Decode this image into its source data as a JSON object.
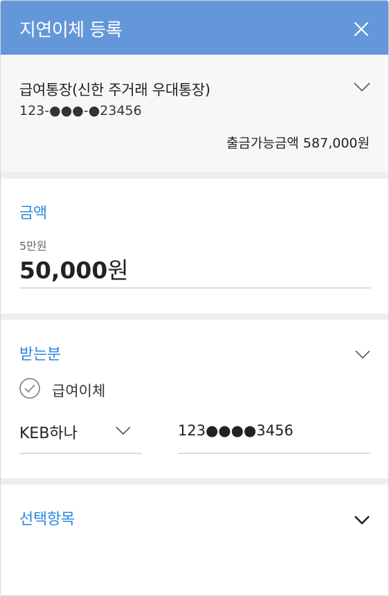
{
  "header": {
    "title": "지연이체 등록"
  },
  "account": {
    "name": "급여통장(신한 주거래 우대통장)",
    "number": "123-●●●-●23456",
    "available": "출금가능금액 587,000원"
  },
  "amount": {
    "title": "금액",
    "sub": "5만원",
    "value": "50,000",
    "unit": "원"
  },
  "recipient": {
    "title": "받는분",
    "check_label": "급여이체",
    "bank": "KEB하나",
    "account_no": "123●●●●3456"
  },
  "options": {
    "title": "선택항목"
  },
  "colors": {
    "header_bg": "#6497da",
    "accent": "#2a86e0"
  },
  "icons": [
    "close-icon",
    "chevron-down-icon",
    "check-circle-icon"
  ]
}
